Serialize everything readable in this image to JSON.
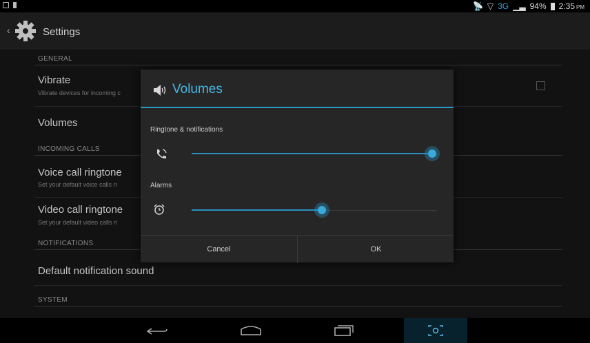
{
  "status_bar": {
    "network": "3G",
    "battery": "94%",
    "time": "2:35",
    "ampm": "PM"
  },
  "action_bar": {
    "title": "Settings",
    "icon": "settings-gear-icon"
  },
  "settings_list": {
    "general_header": "GENERAL",
    "vibrate": {
      "title": "Vibrate",
      "subtitle": "Vibrate devices for incoming c"
    },
    "volumes": {
      "title": "Volumes"
    },
    "incoming_calls_header": "INCOMING CALLS",
    "voice_ringtone": {
      "title": "Voice call ringtone",
      "subtitle": "Set your default voice calls ri"
    },
    "video_ringtone": {
      "title": "Video call ringtone",
      "subtitle": "Set your default video calls ri"
    },
    "notifications_header": "NOTIFICATIONS",
    "default_notification": {
      "title": "Default notification sound"
    },
    "system_header": "SYSTEM"
  },
  "dialog": {
    "title": "Volumes",
    "ringtone_label": "Ringtone & notifications",
    "ringtone_level": 0.98,
    "alarms_label": "Alarms",
    "alarms_level": 0.53,
    "cancel_label": "Cancel",
    "ok_label": "OK"
  },
  "nav_bar": {
    "icons": [
      "back-icon",
      "home-icon",
      "recent-apps-icon",
      "screenshot-icon"
    ]
  },
  "colors": {
    "accent": "#2b9bce",
    "dialog_bg": "#262626",
    "list_bg": "#121212"
  }
}
